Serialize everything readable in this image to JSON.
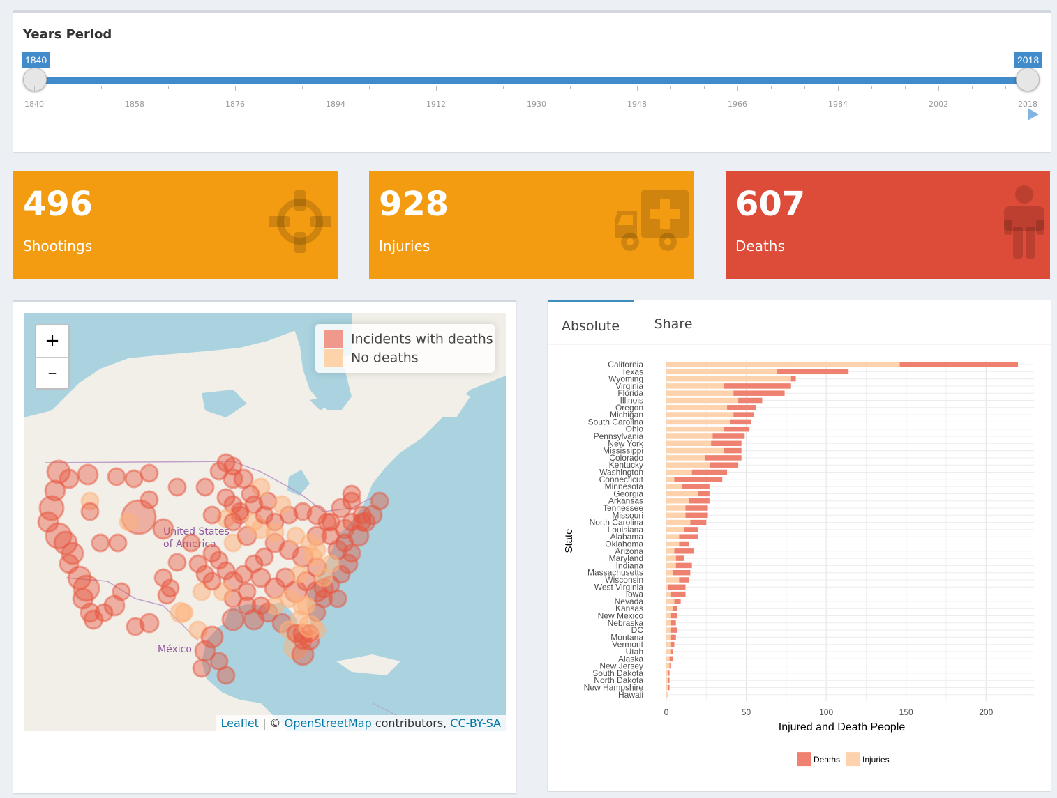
{
  "slider": {
    "title": "Years Period",
    "min_label": "1840",
    "max_label": "2018",
    "ticks": [
      "1840",
      "1858",
      "1876",
      "1894",
      "1912",
      "1930",
      "1948",
      "1966",
      "1984",
      "2002",
      "2018"
    ],
    "range": [
      1840,
      2018
    ],
    "selected": [
      1840,
      2018
    ],
    "play_icon": "play-icon"
  },
  "value_boxes": [
    {
      "value": "496",
      "label": "Shootings",
      "icon": "crosshairs-icon",
      "color": "#f39c12"
    },
    {
      "value": "928",
      "label": "Injuries",
      "icon": "ambulance-icon",
      "color": "#f39c12"
    },
    {
      "value": "607",
      "label": "Deaths",
      "icon": "male-icon",
      "color": "#dd4b39"
    }
  ],
  "map": {
    "zoom_in": "+",
    "zoom_out": "–",
    "legend": [
      {
        "label": "Incidents with deaths",
        "color": "#f0988c"
      },
      {
        "label": "No deaths",
        "color": "#fdd3a9"
      }
    ],
    "place_labels": {
      "usa_line1": "United States",
      "usa_line2": "of America",
      "mexico": "México"
    },
    "attribution": {
      "leaflet": "Leaflet",
      "sep": " | © ",
      "osm": "OpenStreetMap",
      "contrib": " contributors, ",
      "license": "CC-BY-SA"
    }
  },
  "tabs": {
    "absolute": "Absolute",
    "share": "Share",
    "active": "Absolute"
  },
  "chart_data": {
    "type": "bar",
    "orientation": "horizontal",
    "stacked": true,
    "xlabel": "Injured and Death People",
    "ylabel": "State",
    "xlim": [
      0,
      230
    ],
    "xticks": [
      0,
      50,
      100,
      150,
      200
    ],
    "legend_position": "bottom",
    "series_colors": {
      "Deaths": "#ee8170",
      "Injuries": "#fdd2ac"
    },
    "categories": [
      "California",
      "Texas",
      "Wyoming",
      "Virginia",
      "Florida",
      "Illinois",
      "Oregon",
      "Michigan",
      "South Carolina",
      "Ohio",
      "Pennsylvania",
      "New York",
      "Mississippi",
      "Colorado",
      "Kentucky",
      "Washington",
      "Connecticut",
      "Minnesota",
      "Georgia",
      "Arkansas",
      "Tennessee",
      "Missouri",
      "North Carolina",
      "Louisiana",
      "Alabama",
      "Oklahoma",
      "Arizona",
      "Maryland",
      "Indiana",
      "Massachusetts",
      "Wisconsin",
      "West Virginia",
      "Iowa",
      "Nevada",
      "Kansas",
      "New Mexico",
      "Nebraska",
      "DC",
      "Montana",
      "Vermont",
      "Utah",
      "Alaska",
      "New Jersey",
      "South Dakota",
      "North Dakota",
      "New Hampshire",
      "Hawaii"
    ],
    "series": [
      {
        "name": "Injuries",
        "values": [
          146,
          69,
          78,
          36,
          42,
          45,
          38,
          42,
          40,
          36,
          29,
          28,
          36,
          24,
          27,
          16,
          5,
          10,
          20,
          14,
          12,
          12,
          15,
          11,
          8,
          8,
          5,
          6,
          6,
          4,
          8,
          1,
          3,
          5,
          4,
          3,
          3,
          3,
          3,
          3,
          3,
          2,
          2,
          1,
          1,
          1,
          1
        ]
      },
      {
        "name": "Deaths",
        "values": [
          74,
          45,
          3,
          42,
          32,
          15,
          18,
          13,
          13,
          16,
          20,
          19,
          11,
          23,
          18,
          22,
          30,
          17,
          7,
          13,
          14,
          14,
          10,
          9,
          12,
          6,
          12,
          5,
          10,
          11,
          6,
          11,
          9,
          4,
          3,
          4,
          3,
          4,
          3,
          2,
          1,
          2,
          1,
          1,
          1,
          1,
          0
        ]
      }
    ]
  }
}
